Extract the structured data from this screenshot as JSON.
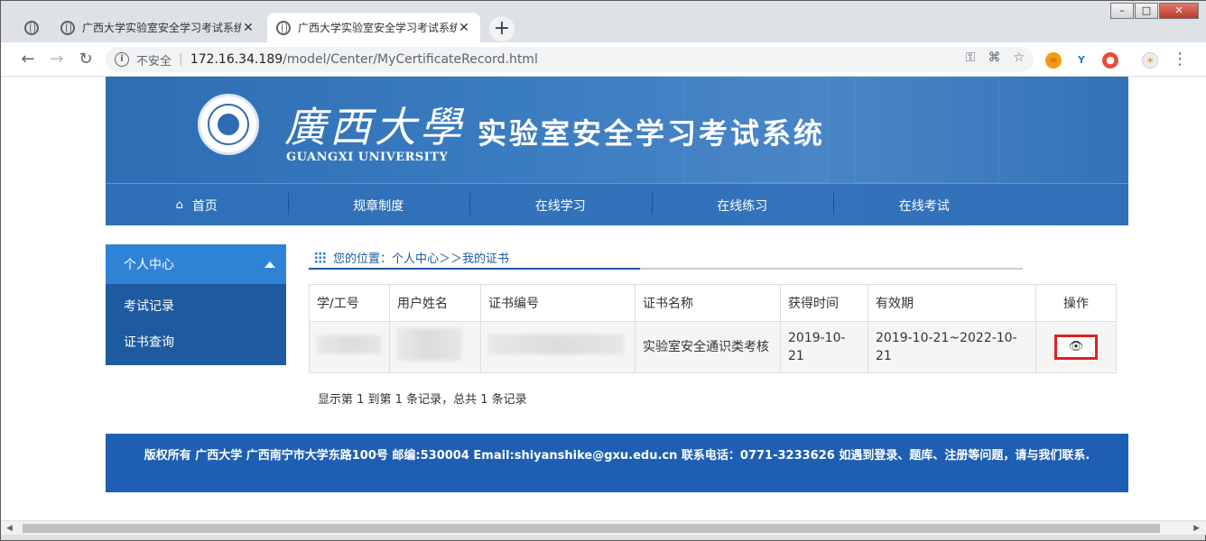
{
  "tabs": [
    {
      "title": "广西大学实验室安全学习考试系统"
    },
    {
      "title": "广西大学实验室安全学习考试系统"
    }
  ],
  "address": {
    "security_label": "不安全",
    "host": "172.16.34.189",
    "path": "/model/Center/MyCertificateRecord.html"
  },
  "banner": {
    "brand_cn": "廣西大學",
    "brand_en": "GUANGXI UNIVERSITY",
    "system_title": "实验室安全学习考试系统"
  },
  "nav": {
    "home": "首页",
    "items": [
      "规章制度",
      "在线学习",
      "在线练习",
      "在线考试"
    ]
  },
  "sidebar": {
    "header": "个人中心",
    "items": [
      "考试记录",
      "证书查询"
    ]
  },
  "breadcrumb": "您的位置：个人中心＞＞我的证书",
  "table": {
    "headers": [
      "学/工号",
      "用户姓名",
      "证书编号",
      "证书名称",
      "获得时间",
      "有效期",
      "操作"
    ],
    "rows": [
      {
        "cert_name": "实验室安全通识类考核",
        "obtained": "2019-10-21",
        "validity": "2019-10-21~2022-10-21"
      }
    ]
  },
  "pager": "显示第 1 到第 1 条记录，总共 1 条记录",
  "footer": "版权所有  广西大学 广西南宁市大学东路100号 邮编:530004 Email:shiyanshike@gxu.edu.cn 联系电话：0771-3233626 如遇到登录、题库、注册等问题，请与我们联系.",
  "colors": {
    "banner": "#3a7cc1",
    "footer": "#1e5fb3",
    "sidebar_head": "#2f83d6",
    "highlight": "#e02020"
  }
}
